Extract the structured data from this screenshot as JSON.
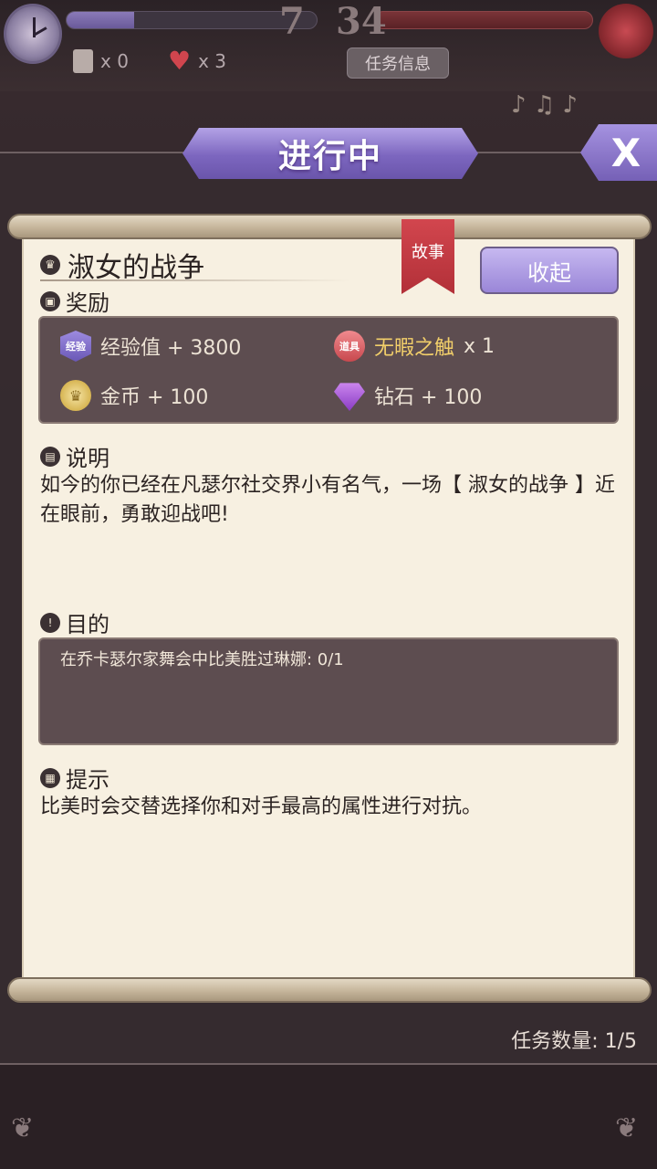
{
  "hud": {
    "score_left": "7",
    "score_right": "34",
    "scroll_count": "x 0",
    "heart_count": "x 3",
    "task_info_button": "任务信息",
    "progress_left": 0.27
  },
  "dialog": {
    "header_title": "进行中",
    "close_label": "X",
    "quest_title": "淑女的战争",
    "ribbon_label": "故事",
    "collapse_button": "收起",
    "rewards_label": "奖励",
    "rewards": {
      "exp_badge": "经验",
      "exp_text": "经验值 + 3800",
      "item_badge": "道具",
      "item_name": "无暇之触",
      "item_qty": "x 1",
      "coin_text": "金币 + 100",
      "diamond_text": "钻石 + 100"
    },
    "description_label": "说明",
    "description_text": "如今的你已经在凡瑟尔社交界小有名气，一场【 淑女的战争 】近在眼前，勇敢迎战吧!",
    "objective_label": "目的",
    "objective_text": "在乔卡瑟尔家舞会中比美胜过琳娜: 0/1",
    "tip_label": "提示",
    "tip_text": "比美时会交替选择你和对手最高的属性进行对抗。",
    "quest_count": "任务数量: 1/5"
  },
  "colors": {
    "accent_purple": "#7c66bf",
    "ribbon_red": "#c8404a",
    "parchment": "#f7f0e1",
    "dark_panel": "#5d4d50"
  }
}
